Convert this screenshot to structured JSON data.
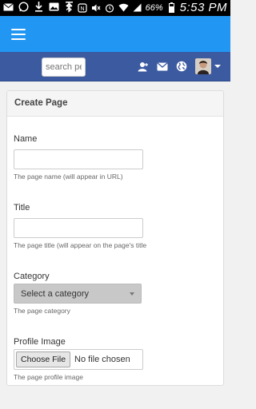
{
  "status_bar": {
    "battery": "66%",
    "time": "5:53 PM"
  },
  "app_bar": {
    "menu_icon": "hamburger-menu-icon",
    "accent": "#2196f3"
  },
  "nav": {
    "search_placeholder": "search pe",
    "icons": [
      "user-add-icon",
      "mail-icon",
      "globe-icon"
    ],
    "bar_color": "#3b5aa0"
  },
  "form": {
    "title": "Create Page",
    "fields": {
      "name": {
        "label": "Name",
        "value": "",
        "help": "The page name (will appear in URL)"
      },
      "title": {
        "label": "Title",
        "value": "",
        "help": "The page title (will appear on the page's title"
      },
      "category": {
        "label": "Category",
        "selected": "Select a category",
        "help": "The page category"
      },
      "profile_image": {
        "label": "Profile Image",
        "button": "Choose File",
        "status": "No file chosen",
        "help": "The page profile image"
      }
    }
  }
}
